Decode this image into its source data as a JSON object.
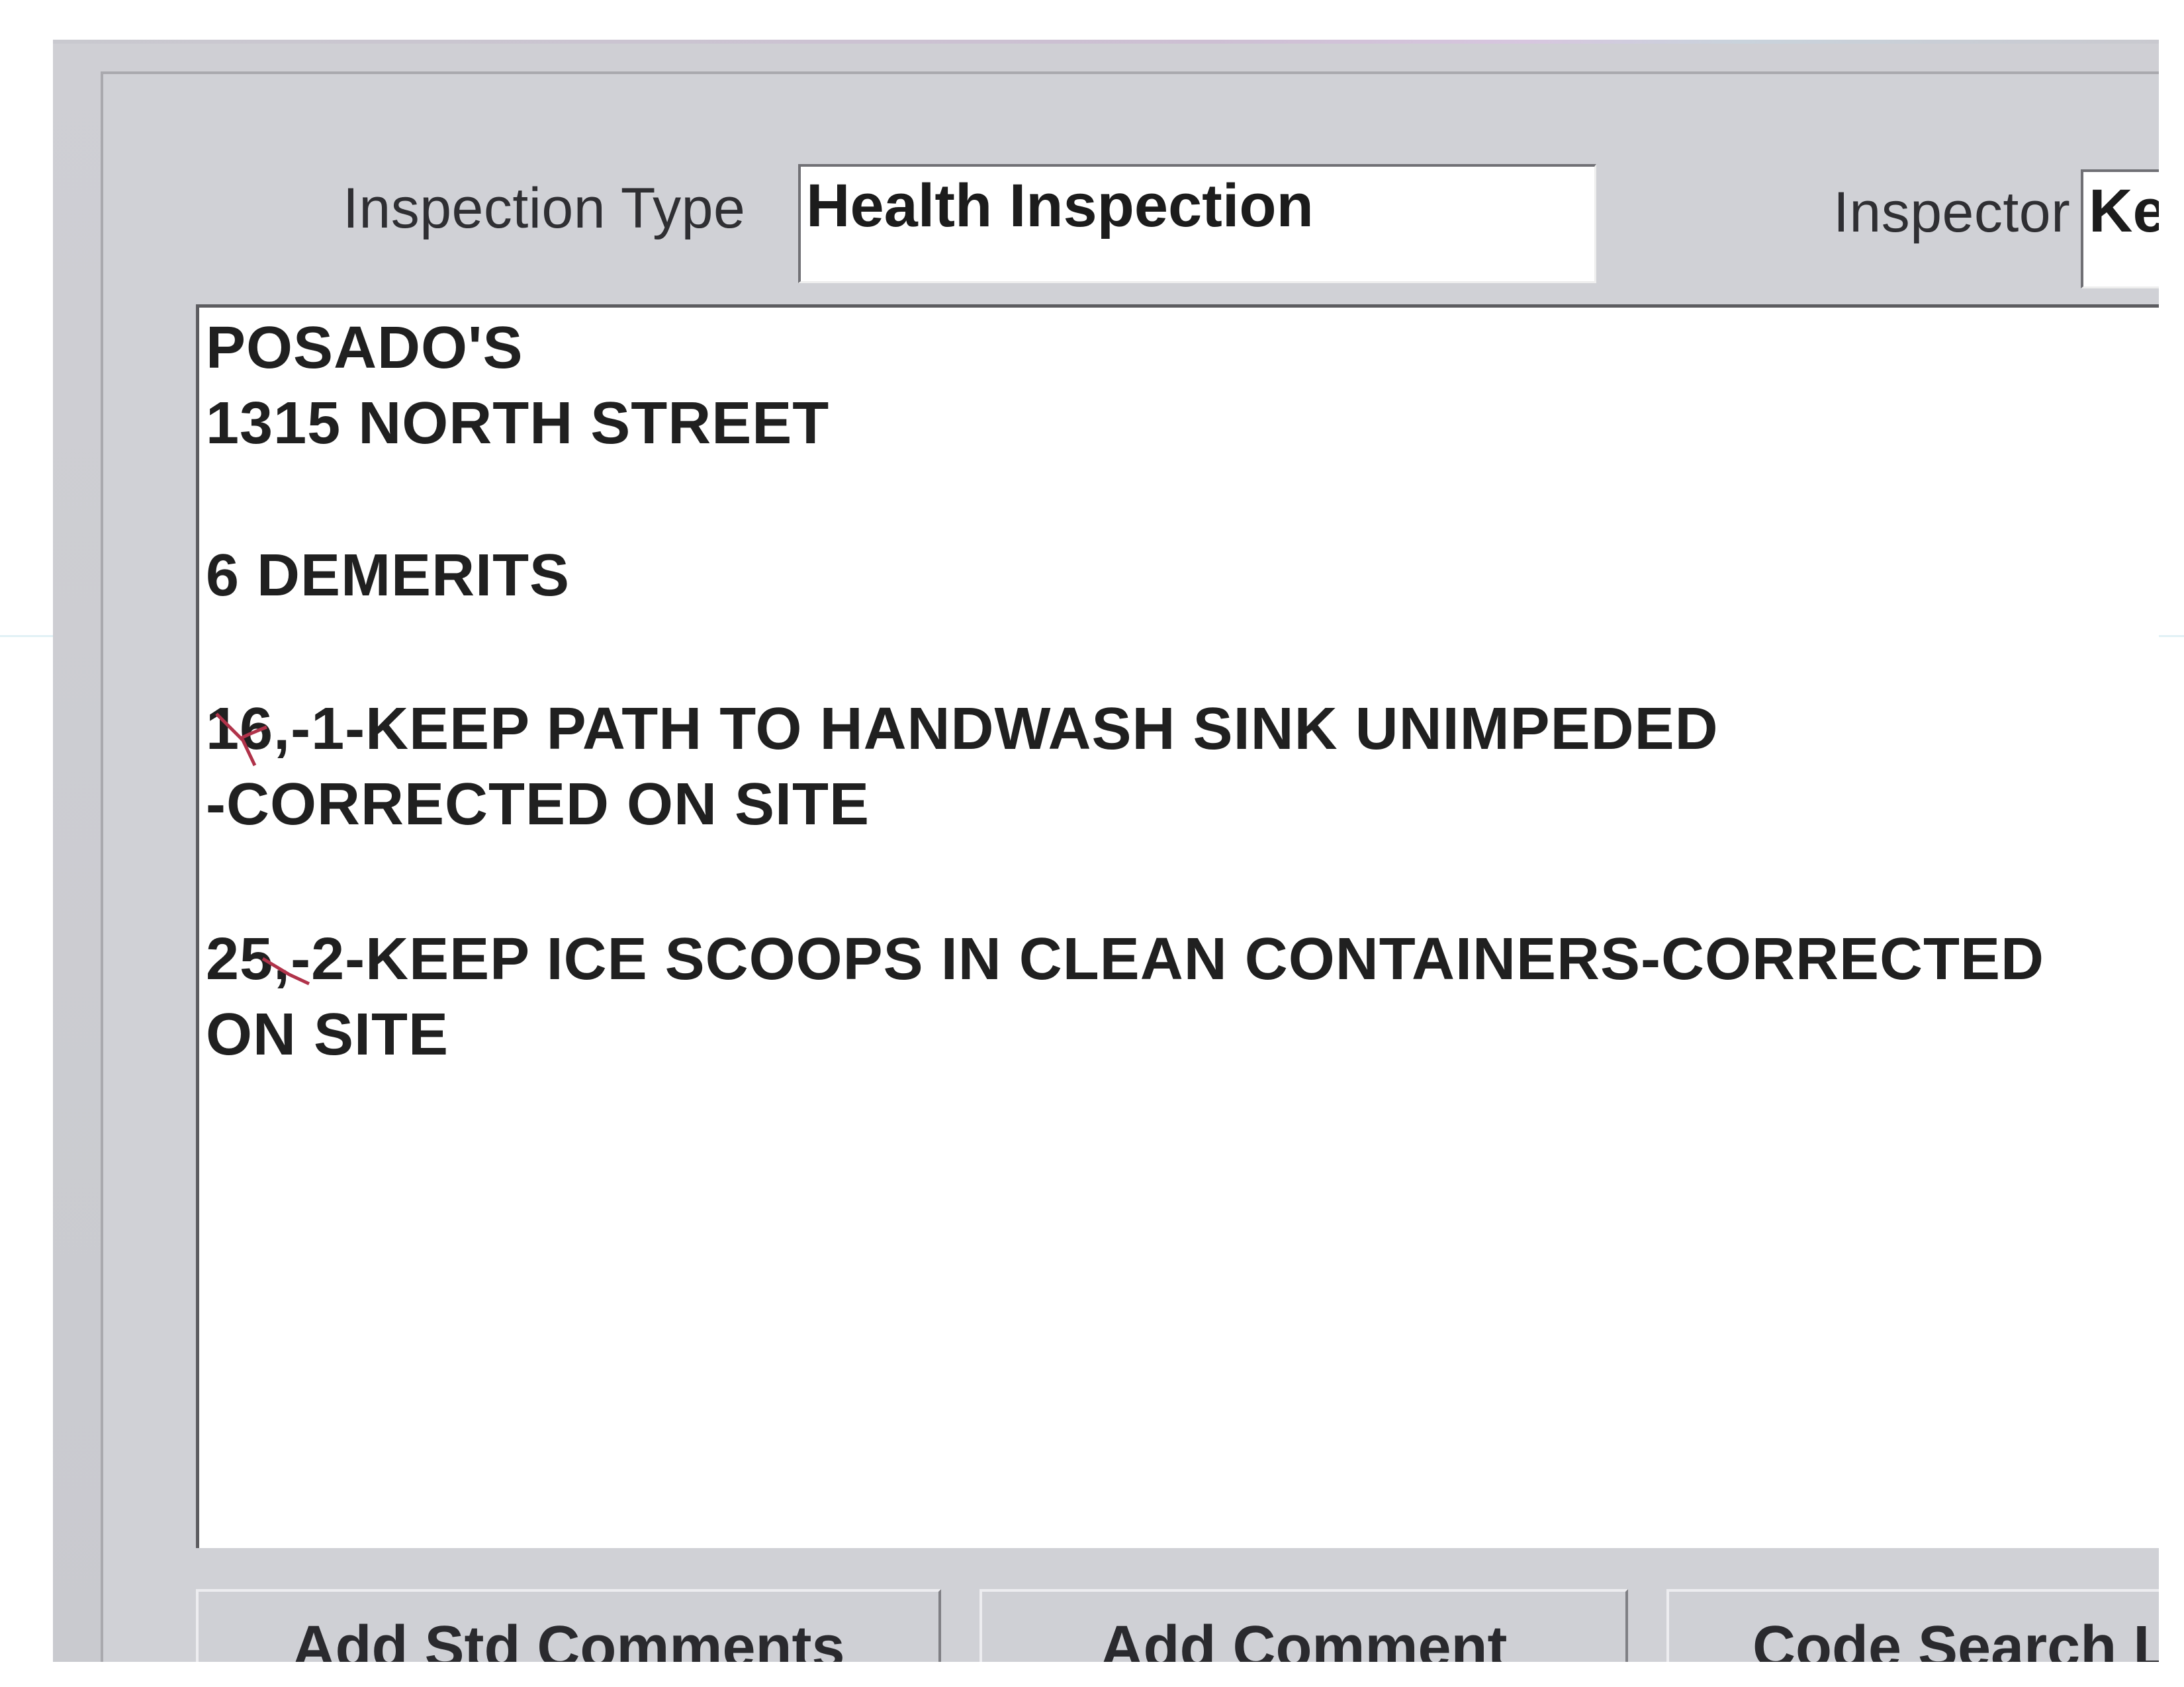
{
  "header": {
    "inspection_type_label": "Inspection Type",
    "inspection_type_value": "Health Inspection",
    "inspector_label": "Inspector",
    "inspector_value": "Ke"
  },
  "notes": {
    "lines": [
      "POSADO'S",
      "1315 NORTH STREET",
      "",
      "6 DEMERITS",
      "",
      "16,-1-KEEP PATH TO HANDWASH SINK UNIMPEDED",
      "-CORRECTED ON SITE",
      "",
      "25,-2-KEEP ICE SCOOPS IN CLEAN CONTAINERS-CORRECTED",
      "ON SITE"
    ]
  },
  "buttons": {
    "add_std_comments_pre": "Add ",
    "add_std_comments_hotkey": "S",
    "add_std_comments_post": "td Comments",
    "add_comment_hotkey": "A",
    "add_comment_post": "dd Comment",
    "code_search_label": "Code Search Li"
  }
}
